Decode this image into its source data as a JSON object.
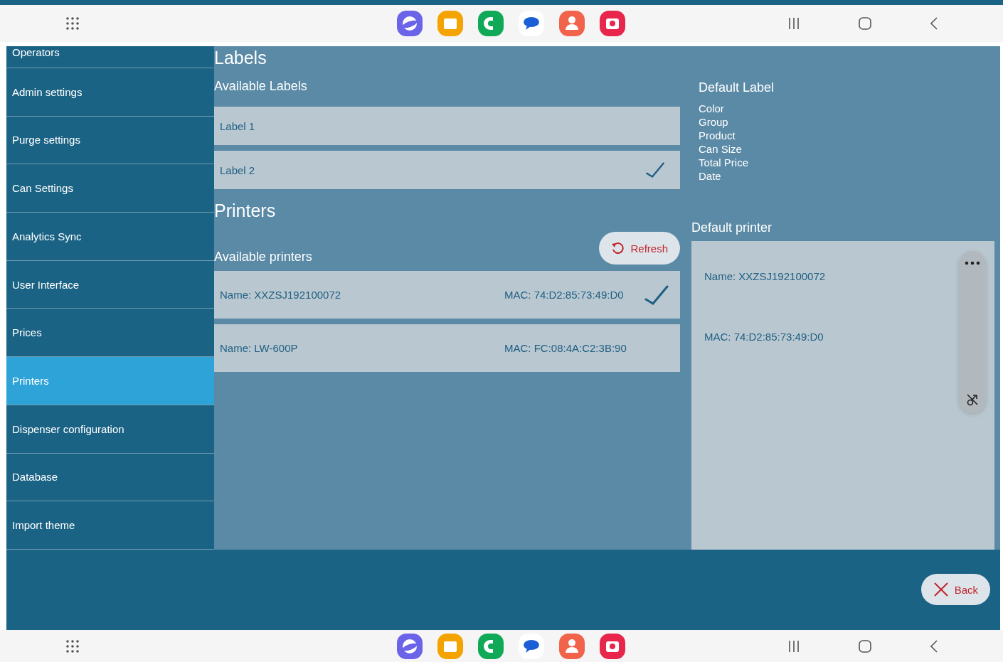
{
  "sidebar": {
    "items": [
      {
        "label": "Operators",
        "selected": false
      },
      {
        "label": "Admin settings",
        "selected": false
      },
      {
        "label": "Purge settings",
        "selected": false
      },
      {
        "label": "Can Settings",
        "selected": false
      },
      {
        "label": "Analytics Sync",
        "selected": false
      },
      {
        "label": "User Interface",
        "selected": false
      },
      {
        "label": "Prices",
        "selected": false
      },
      {
        "label": "Printers",
        "selected": true
      },
      {
        "label": "Dispenser configuration",
        "selected": false
      },
      {
        "label": "Database",
        "selected": false
      },
      {
        "label": "Import theme",
        "selected": false
      }
    ]
  },
  "labels": {
    "title": "Labels",
    "available_title": "Available Labels",
    "items": [
      {
        "label": "Label 1",
        "selected": false
      },
      {
        "label": "Label 2",
        "selected": true
      }
    ],
    "default_title": "Default Label",
    "default_fields": [
      "Color",
      "Group",
      "Product",
      "Can Size",
      "Total Price",
      "Date"
    ]
  },
  "printers": {
    "title": "Printers",
    "available_title": "Available printers",
    "refresh_button": "Refresh",
    "items": [
      {
        "name": "Name: XXZSJ192100072",
        "mac": "MAC: 74:D2:85:73:49:D0",
        "selected": true
      },
      {
        "name": "Name: LW-600P",
        "mac": "MAC: FC:08:4A:C2:3B:90",
        "selected": false
      }
    ],
    "default_title": "Default printer",
    "default_name": "Name: XXZSJ192100072",
    "default_mac": "MAC: 74:D2:85:73:49:D0"
  },
  "back_button": "Back"
}
